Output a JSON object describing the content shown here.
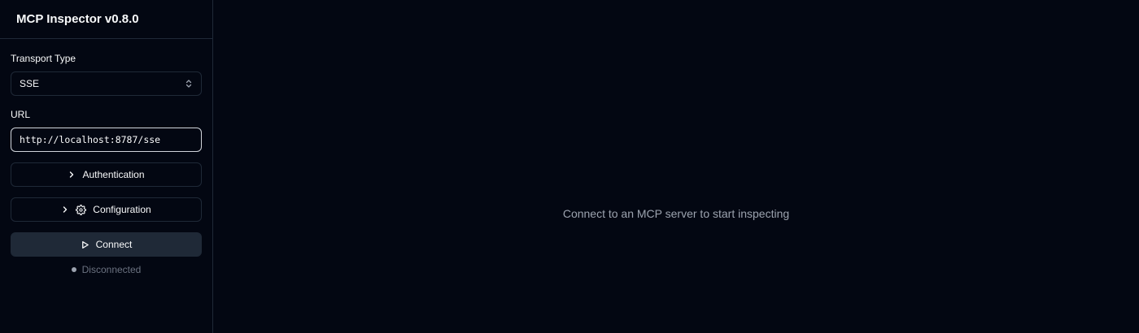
{
  "sidebar": {
    "title": "MCP Inspector v0.8.0",
    "transport_label": "Transport Type",
    "transport_value": "SSE",
    "url_label": "URL",
    "url_value": "http://localhost:8787/sse",
    "auth_label": "Authentication",
    "config_label": "Configuration",
    "connect_label": "Connect",
    "status_text": "Disconnected"
  },
  "main": {
    "empty_message": "Connect to an MCP server to start inspecting"
  },
  "colors": {
    "background": "#030712",
    "border": "#1f2937",
    "connect_button": "#1f2937",
    "muted_text": "#9ca3af"
  },
  "icons": [
    "chevron-up-down-icon",
    "chevron-right-icon",
    "gear-icon",
    "play-icon",
    "status-dot-icon"
  ]
}
